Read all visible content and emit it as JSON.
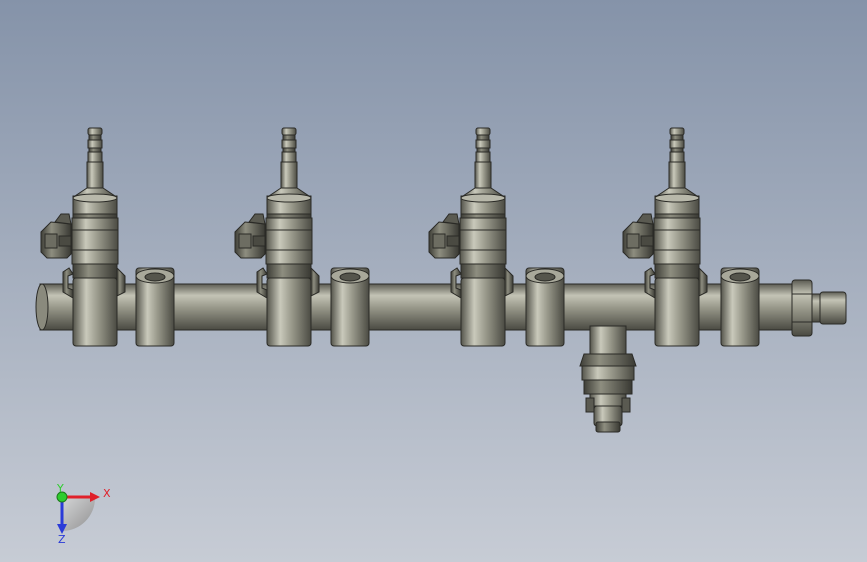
{
  "viewport": {
    "background_top": "#8593a9",
    "background_bottom": "#c7ccd5"
  },
  "model": {
    "injector_count": 4,
    "boss_count": 4,
    "part_color": "#8d8d80",
    "part_highlight": "#c9c9bb",
    "part_shadow": "#4f4f47",
    "edge_color": "#2a2a26"
  },
  "triad": {
    "x_label": "X",
    "y_label": "Y",
    "z_label": "Z",
    "x_color": "#e0202a",
    "y_color": "#2ecc2e",
    "z_color": "#2a3bd8"
  }
}
